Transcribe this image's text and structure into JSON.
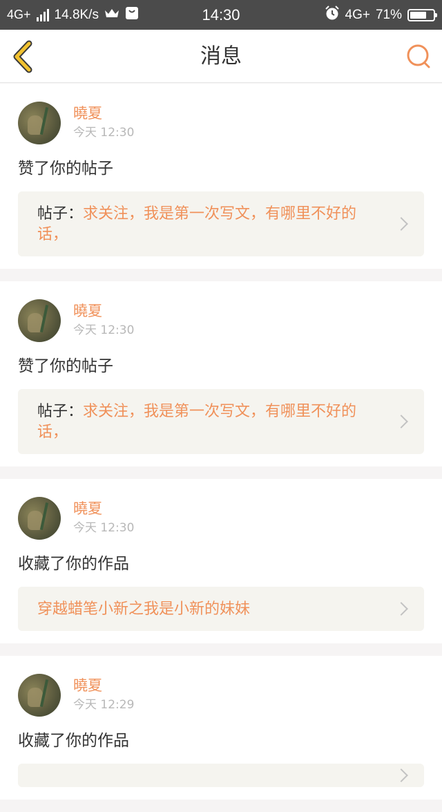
{
  "status_bar": {
    "network_left": "4G+",
    "speed": "14.8K/s",
    "time": "14:30",
    "network_right": "4G+",
    "battery": "71%",
    "battery_level": 0.71
  },
  "nav": {
    "title": "消息"
  },
  "messages": [
    {
      "username": "曉夏",
      "time": "今天 12:30",
      "action": "赞了你的帖子",
      "ref_prefix": "帖子：",
      "ref_text": "求关注，我是第一次写文，有哪里不好的话，"
    },
    {
      "username": "曉夏",
      "time": "今天 12:30",
      "action": "赞了你的帖子",
      "ref_prefix": "帖子：",
      "ref_text": "求关注，我是第一次写文，有哪里不好的话，"
    },
    {
      "username": "曉夏",
      "time": "今天 12:30",
      "action": "收藏了你的作品",
      "ref_prefix": "",
      "ref_text": "穿越蜡笔小新之我是小新的妹妹"
    },
    {
      "username": "曉夏",
      "time": "今天 12:29",
      "action": "收藏了你的作品",
      "ref_prefix": "",
      "ref_text": ""
    }
  ],
  "colors": {
    "accent": "#f0915a",
    "back_arrow": "#f2c230",
    "status_bar": "#4b4b4b"
  }
}
